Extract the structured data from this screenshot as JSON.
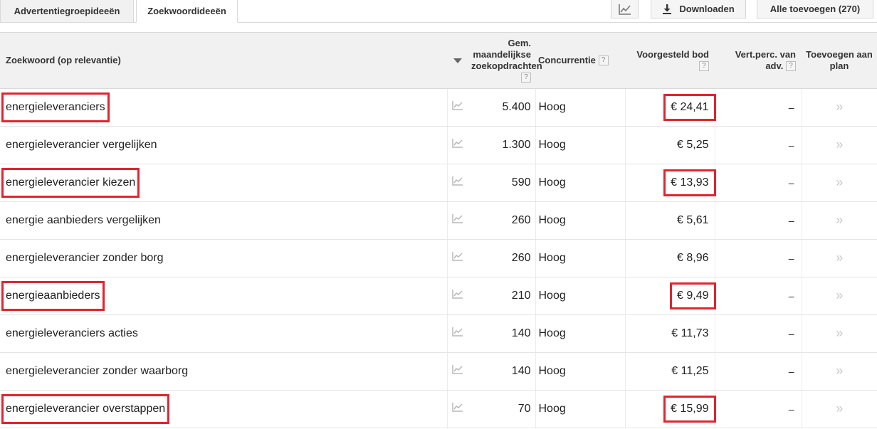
{
  "tabs": [
    {
      "label": "Advertentiegroepideeën",
      "active": false
    },
    {
      "label": "Zoekwoordideeën",
      "active": true
    }
  ],
  "toolbar": {
    "chart_icon": "line-chart-icon",
    "download_icon": "download-icon",
    "download_label": "Downloaden",
    "add_all_label": "Alle toevoegen (270)"
  },
  "table": {
    "headers": {
      "keyword": "Zoekwoord (op relevantie)",
      "volume": "Gem. maandelijkse zoekopdrachten",
      "competition": "Concurrentie",
      "bid": "Voorgesteld bod",
      "share": "Vert.perc. van adv.",
      "add": "Toevoegen aan plan",
      "help": "?"
    },
    "rows": [
      {
        "keyword": "energieleveranciers",
        "volume": "5.400",
        "competition": "Hoog",
        "bid": "€ 24,41",
        "share": "–",
        "add": "»",
        "highlight": true
      },
      {
        "keyword": "energieleverancier vergelijken",
        "volume": "1.300",
        "competition": "Hoog",
        "bid": "€ 5,25",
        "share": "–",
        "add": "»",
        "highlight": false
      },
      {
        "keyword": "energieleverancier kiezen",
        "volume": "590",
        "competition": "Hoog",
        "bid": "€ 13,93",
        "share": "–",
        "add": "»",
        "highlight": true
      },
      {
        "keyword": "energie aanbieders vergelijken",
        "volume": "260",
        "competition": "Hoog",
        "bid": "€ 5,61",
        "share": "–",
        "add": "»",
        "highlight": false
      },
      {
        "keyword": "energieleverancier zonder borg",
        "volume": "260",
        "competition": "Hoog",
        "bid": "€ 8,96",
        "share": "–",
        "add": "»",
        "highlight": false
      },
      {
        "keyword": "energieaanbieders",
        "volume": "210",
        "competition": "Hoog",
        "bid": "€ 9,49",
        "share": "–",
        "add": "»",
        "highlight": true
      },
      {
        "keyword": "energieleveranciers acties",
        "volume": "140",
        "competition": "Hoog",
        "bid": "€ 11,73",
        "share": "–",
        "add": "»",
        "highlight": false
      },
      {
        "keyword": "energieleverancier zonder waarborg",
        "volume": "140",
        "competition": "Hoog",
        "bid": "€ 11,25",
        "share": "–",
        "add": "»",
        "highlight": false
      },
      {
        "keyword": "energieleverancier overstappen",
        "volume": "70",
        "competition": "Hoog",
        "bid": "€ 15,99",
        "share": "–",
        "add": "»",
        "highlight": true
      }
    ]
  },
  "colors": {
    "highlight_box": "#e0252f",
    "header_bg": "#f1f1f1",
    "tab_bg": "#f1f1f1"
  }
}
